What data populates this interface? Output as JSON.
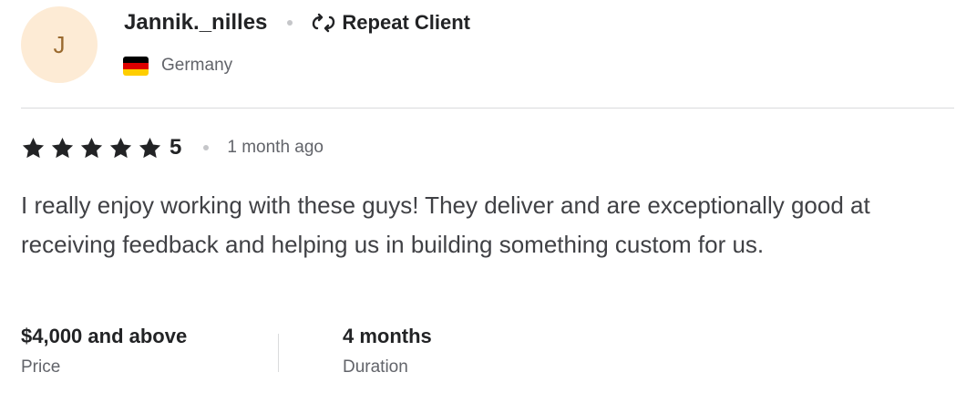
{
  "reviewer": {
    "avatar_initial": "J",
    "username": "Jannik._nilles",
    "badge": "Repeat Client",
    "country": "Germany",
    "flag_colors": [
      "#000000",
      "#dd0000",
      "#ffce00"
    ]
  },
  "rating": {
    "value": "5",
    "stars_filled": 5,
    "stars_total": 5,
    "time_ago": "1 month ago"
  },
  "review": {
    "text": "I really enjoy working with these guys! They deliver and are exceptionally good at receiving feedback and helping us in building something custom for us."
  },
  "stats": {
    "price": {
      "value": "$4,000 and above",
      "label": "Price"
    },
    "duration": {
      "value": "4 months",
      "label": "Duration"
    }
  },
  "colors": {
    "avatar_bg": "#fdebd5",
    "avatar_text": "#9a6a2f",
    "star": "#222325",
    "muted_text": "#62646a",
    "divider": "#dadbdd"
  },
  "icons": [
    "repeat-icon",
    "star-icon",
    "germany-flag-icon"
  ]
}
